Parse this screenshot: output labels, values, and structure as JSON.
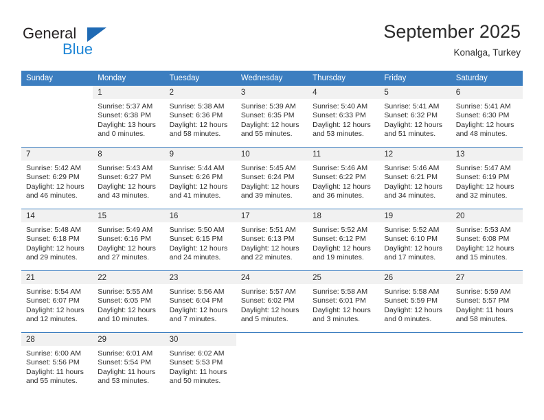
{
  "brand": {
    "word_one": "General",
    "word_two": "Blue",
    "triangle_icon": "triangle-icon",
    "color_dark": "#231f20",
    "color_blue": "#1f86d6",
    "color_triangle": "#1f6ab4"
  },
  "header": {
    "title": "September 2025",
    "subtitle": "Konalga, Turkey"
  },
  "theme": {
    "header_bg": "#3c7ec0",
    "daynum_bg": "#f1f1f1",
    "row_divider": "#3c7ec0",
    "text": "#2b2b2b"
  },
  "weekdays": [
    "Sunday",
    "Monday",
    "Tuesday",
    "Wednesday",
    "Thursday",
    "Friday",
    "Saturday"
  ],
  "weeks": [
    [
      {
        "blank": true,
        "day": "",
        "sunrise": "",
        "sunset": "",
        "daylight_line1": "",
        "daylight_line2": ""
      },
      {
        "day": "1",
        "sunrise": "Sunrise: 5:37 AM",
        "sunset": "Sunset: 6:38 PM",
        "daylight_line1": "Daylight: 13 hours",
        "daylight_line2": "and 0 minutes."
      },
      {
        "day": "2",
        "sunrise": "Sunrise: 5:38 AM",
        "sunset": "Sunset: 6:36 PM",
        "daylight_line1": "Daylight: 12 hours",
        "daylight_line2": "and 58 minutes."
      },
      {
        "day": "3",
        "sunrise": "Sunrise: 5:39 AM",
        "sunset": "Sunset: 6:35 PM",
        "daylight_line1": "Daylight: 12 hours",
        "daylight_line2": "and 55 minutes."
      },
      {
        "day": "4",
        "sunrise": "Sunrise: 5:40 AM",
        "sunset": "Sunset: 6:33 PM",
        "daylight_line1": "Daylight: 12 hours",
        "daylight_line2": "and 53 minutes."
      },
      {
        "day": "5",
        "sunrise": "Sunrise: 5:41 AM",
        "sunset": "Sunset: 6:32 PM",
        "daylight_line1": "Daylight: 12 hours",
        "daylight_line2": "and 51 minutes."
      },
      {
        "day": "6",
        "sunrise": "Sunrise: 5:41 AM",
        "sunset": "Sunset: 6:30 PM",
        "daylight_line1": "Daylight: 12 hours",
        "daylight_line2": "and 48 minutes."
      }
    ],
    [
      {
        "day": "7",
        "sunrise": "Sunrise: 5:42 AM",
        "sunset": "Sunset: 6:29 PM",
        "daylight_line1": "Daylight: 12 hours",
        "daylight_line2": "and 46 minutes."
      },
      {
        "day": "8",
        "sunrise": "Sunrise: 5:43 AM",
        "sunset": "Sunset: 6:27 PM",
        "daylight_line1": "Daylight: 12 hours",
        "daylight_line2": "and 43 minutes."
      },
      {
        "day": "9",
        "sunrise": "Sunrise: 5:44 AM",
        "sunset": "Sunset: 6:26 PM",
        "daylight_line1": "Daylight: 12 hours",
        "daylight_line2": "and 41 minutes."
      },
      {
        "day": "10",
        "sunrise": "Sunrise: 5:45 AM",
        "sunset": "Sunset: 6:24 PM",
        "daylight_line1": "Daylight: 12 hours",
        "daylight_line2": "and 39 minutes."
      },
      {
        "day": "11",
        "sunrise": "Sunrise: 5:46 AM",
        "sunset": "Sunset: 6:22 PM",
        "daylight_line1": "Daylight: 12 hours",
        "daylight_line2": "and 36 minutes."
      },
      {
        "day": "12",
        "sunrise": "Sunrise: 5:46 AM",
        "sunset": "Sunset: 6:21 PM",
        "daylight_line1": "Daylight: 12 hours",
        "daylight_line2": "and 34 minutes."
      },
      {
        "day": "13",
        "sunrise": "Sunrise: 5:47 AM",
        "sunset": "Sunset: 6:19 PM",
        "daylight_line1": "Daylight: 12 hours",
        "daylight_line2": "and 32 minutes."
      }
    ],
    [
      {
        "day": "14",
        "sunrise": "Sunrise: 5:48 AM",
        "sunset": "Sunset: 6:18 PM",
        "daylight_line1": "Daylight: 12 hours",
        "daylight_line2": "and 29 minutes."
      },
      {
        "day": "15",
        "sunrise": "Sunrise: 5:49 AM",
        "sunset": "Sunset: 6:16 PM",
        "daylight_line1": "Daylight: 12 hours",
        "daylight_line2": "and 27 minutes."
      },
      {
        "day": "16",
        "sunrise": "Sunrise: 5:50 AM",
        "sunset": "Sunset: 6:15 PM",
        "daylight_line1": "Daylight: 12 hours",
        "daylight_line2": "and 24 minutes."
      },
      {
        "day": "17",
        "sunrise": "Sunrise: 5:51 AM",
        "sunset": "Sunset: 6:13 PM",
        "daylight_line1": "Daylight: 12 hours",
        "daylight_line2": "and 22 minutes."
      },
      {
        "day": "18",
        "sunrise": "Sunrise: 5:52 AM",
        "sunset": "Sunset: 6:12 PM",
        "daylight_line1": "Daylight: 12 hours",
        "daylight_line2": "and 19 minutes."
      },
      {
        "day": "19",
        "sunrise": "Sunrise: 5:52 AM",
        "sunset": "Sunset: 6:10 PM",
        "daylight_line1": "Daylight: 12 hours",
        "daylight_line2": "and 17 minutes."
      },
      {
        "day": "20",
        "sunrise": "Sunrise: 5:53 AM",
        "sunset": "Sunset: 6:08 PM",
        "daylight_line1": "Daylight: 12 hours",
        "daylight_line2": "and 15 minutes."
      }
    ],
    [
      {
        "day": "21",
        "sunrise": "Sunrise: 5:54 AM",
        "sunset": "Sunset: 6:07 PM",
        "daylight_line1": "Daylight: 12 hours",
        "daylight_line2": "and 12 minutes."
      },
      {
        "day": "22",
        "sunrise": "Sunrise: 5:55 AM",
        "sunset": "Sunset: 6:05 PM",
        "daylight_line1": "Daylight: 12 hours",
        "daylight_line2": "and 10 minutes."
      },
      {
        "day": "23",
        "sunrise": "Sunrise: 5:56 AM",
        "sunset": "Sunset: 6:04 PM",
        "daylight_line1": "Daylight: 12 hours",
        "daylight_line2": "and 7 minutes."
      },
      {
        "day": "24",
        "sunrise": "Sunrise: 5:57 AM",
        "sunset": "Sunset: 6:02 PM",
        "daylight_line1": "Daylight: 12 hours",
        "daylight_line2": "and 5 minutes."
      },
      {
        "day": "25",
        "sunrise": "Sunrise: 5:58 AM",
        "sunset": "Sunset: 6:01 PM",
        "daylight_line1": "Daylight: 12 hours",
        "daylight_line2": "and 3 minutes."
      },
      {
        "day": "26",
        "sunrise": "Sunrise: 5:58 AM",
        "sunset": "Sunset: 5:59 PM",
        "daylight_line1": "Daylight: 12 hours",
        "daylight_line2": "and 0 minutes."
      },
      {
        "day": "27",
        "sunrise": "Sunrise: 5:59 AM",
        "sunset": "Sunset: 5:57 PM",
        "daylight_line1": "Daylight: 11 hours",
        "daylight_line2": "and 58 minutes."
      }
    ],
    [
      {
        "day": "28",
        "sunrise": "Sunrise: 6:00 AM",
        "sunset": "Sunset: 5:56 PM",
        "daylight_line1": "Daylight: 11 hours",
        "daylight_line2": "and 55 minutes."
      },
      {
        "day": "29",
        "sunrise": "Sunrise: 6:01 AM",
        "sunset": "Sunset: 5:54 PM",
        "daylight_line1": "Daylight: 11 hours",
        "daylight_line2": "and 53 minutes."
      },
      {
        "day": "30",
        "sunrise": "Sunrise: 6:02 AM",
        "sunset": "Sunset: 5:53 PM",
        "daylight_line1": "Daylight: 11 hours",
        "daylight_line2": "and 50 minutes."
      },
      {
        "blank": true,
        "day": "",
        "sunrise": "",
        "sunset": "",
        "daylight_line1": "",
        "daylight_line2": ""
      },
      {
        "blank": true,
        "day": "",
        "sunrise": "",
        "sunset": "",
        "daylight_line1": "",
        "daylight_line2": ""
      },
      {
        "blank": true,
        "day": "",
        "sunrise": "",
        "sunset": "",
        "daylight_line1": "",
        "daylight_line2": ""
      },
      {
        "blank": true,
        "day": "",
        "sunrise": "",
        "sunset": "",
        "daylight_line1": "",
        "daylight_line2": ""
      }
    ]
  ]
}
